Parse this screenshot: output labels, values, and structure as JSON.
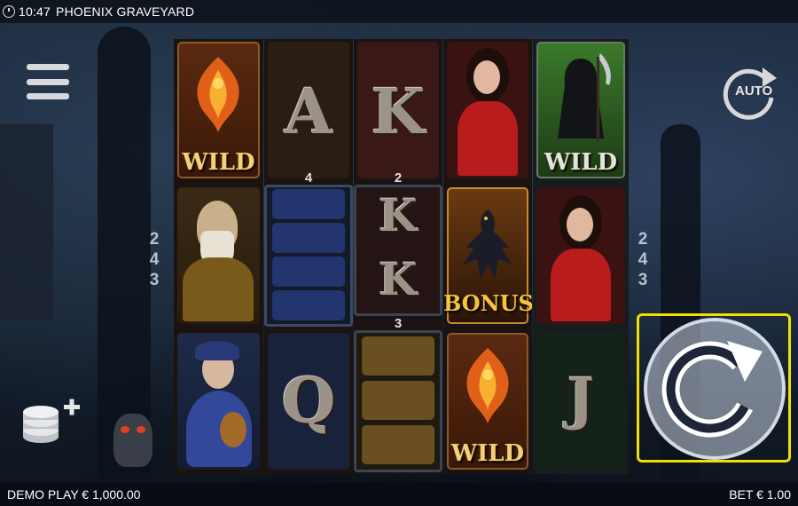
{
  "status_bar": {
    "time": "10:47",
    "game_title": "PHOENIX GRAVEYARD",
    "clock_icon": "clock-icon"
  },
  "footer": {
    "left_label": "DEMO PLAY € 1,000.00",
    "bet_label": "BET € 1.00"
  },
  "controls": {
    "menu_icon": "hamburger-menu-icon",
    "auto_label": "AUTO",
    "coins_icon": "coin-stack-plus-icon",
    "spin_icon": "spin-arrow-icon"
  },
  "side_counters": {
    "left": [
      "2",
      "4",
      "3"
    ],
    "right": [
      "2",
      "4",
      "3"
    ]
  },
  "reels": [
    {
      "index": 1,
      "symbols": [
        "phoenix-wild",
        "maiden-red",
        "musician-blue"
      ],
      "labels": {
        "wild": "WILD"
      }
    },
    {
      "index": 2,
      "count": "4",
      "symbols": [
        "ace-A",
        "musician-blue x4",
        "queen-Q"
      ],
      "letters": {
        "top": "A",
        "bottom": "Q"
      }
    },
    {
      "index": 3,
      "count_top": "2",
      "count_bottom": "3",
      "symbols": [
        "king-K",
        "king-K x2",
        "old-man x3"
      ],
      "letters": {
        "k": "K"
      }
    },
    {
      "index": 4,
      "symbols": [
        "maiden-red",
        "raven-bonus",
        "phoenix-wild"
      ],
      "labels": {
        "bonus": "BONUS",
        "wild": "WILD"
      }
    },
    {
      "index": 5,
      "symbols": [
        "reaper-wild",
        "maiden-red",
        "jack-J"
      ],
      "labels": {
        "wild": "WILD"
      },
      "letters": {
        "j": "J"
      }
    }
  ],
  "colors": {
    "highlight": "#f0e000",
    "wild_gold": "#f4d07a",
    "bonus_gold": "#f7c340"
  }
}
